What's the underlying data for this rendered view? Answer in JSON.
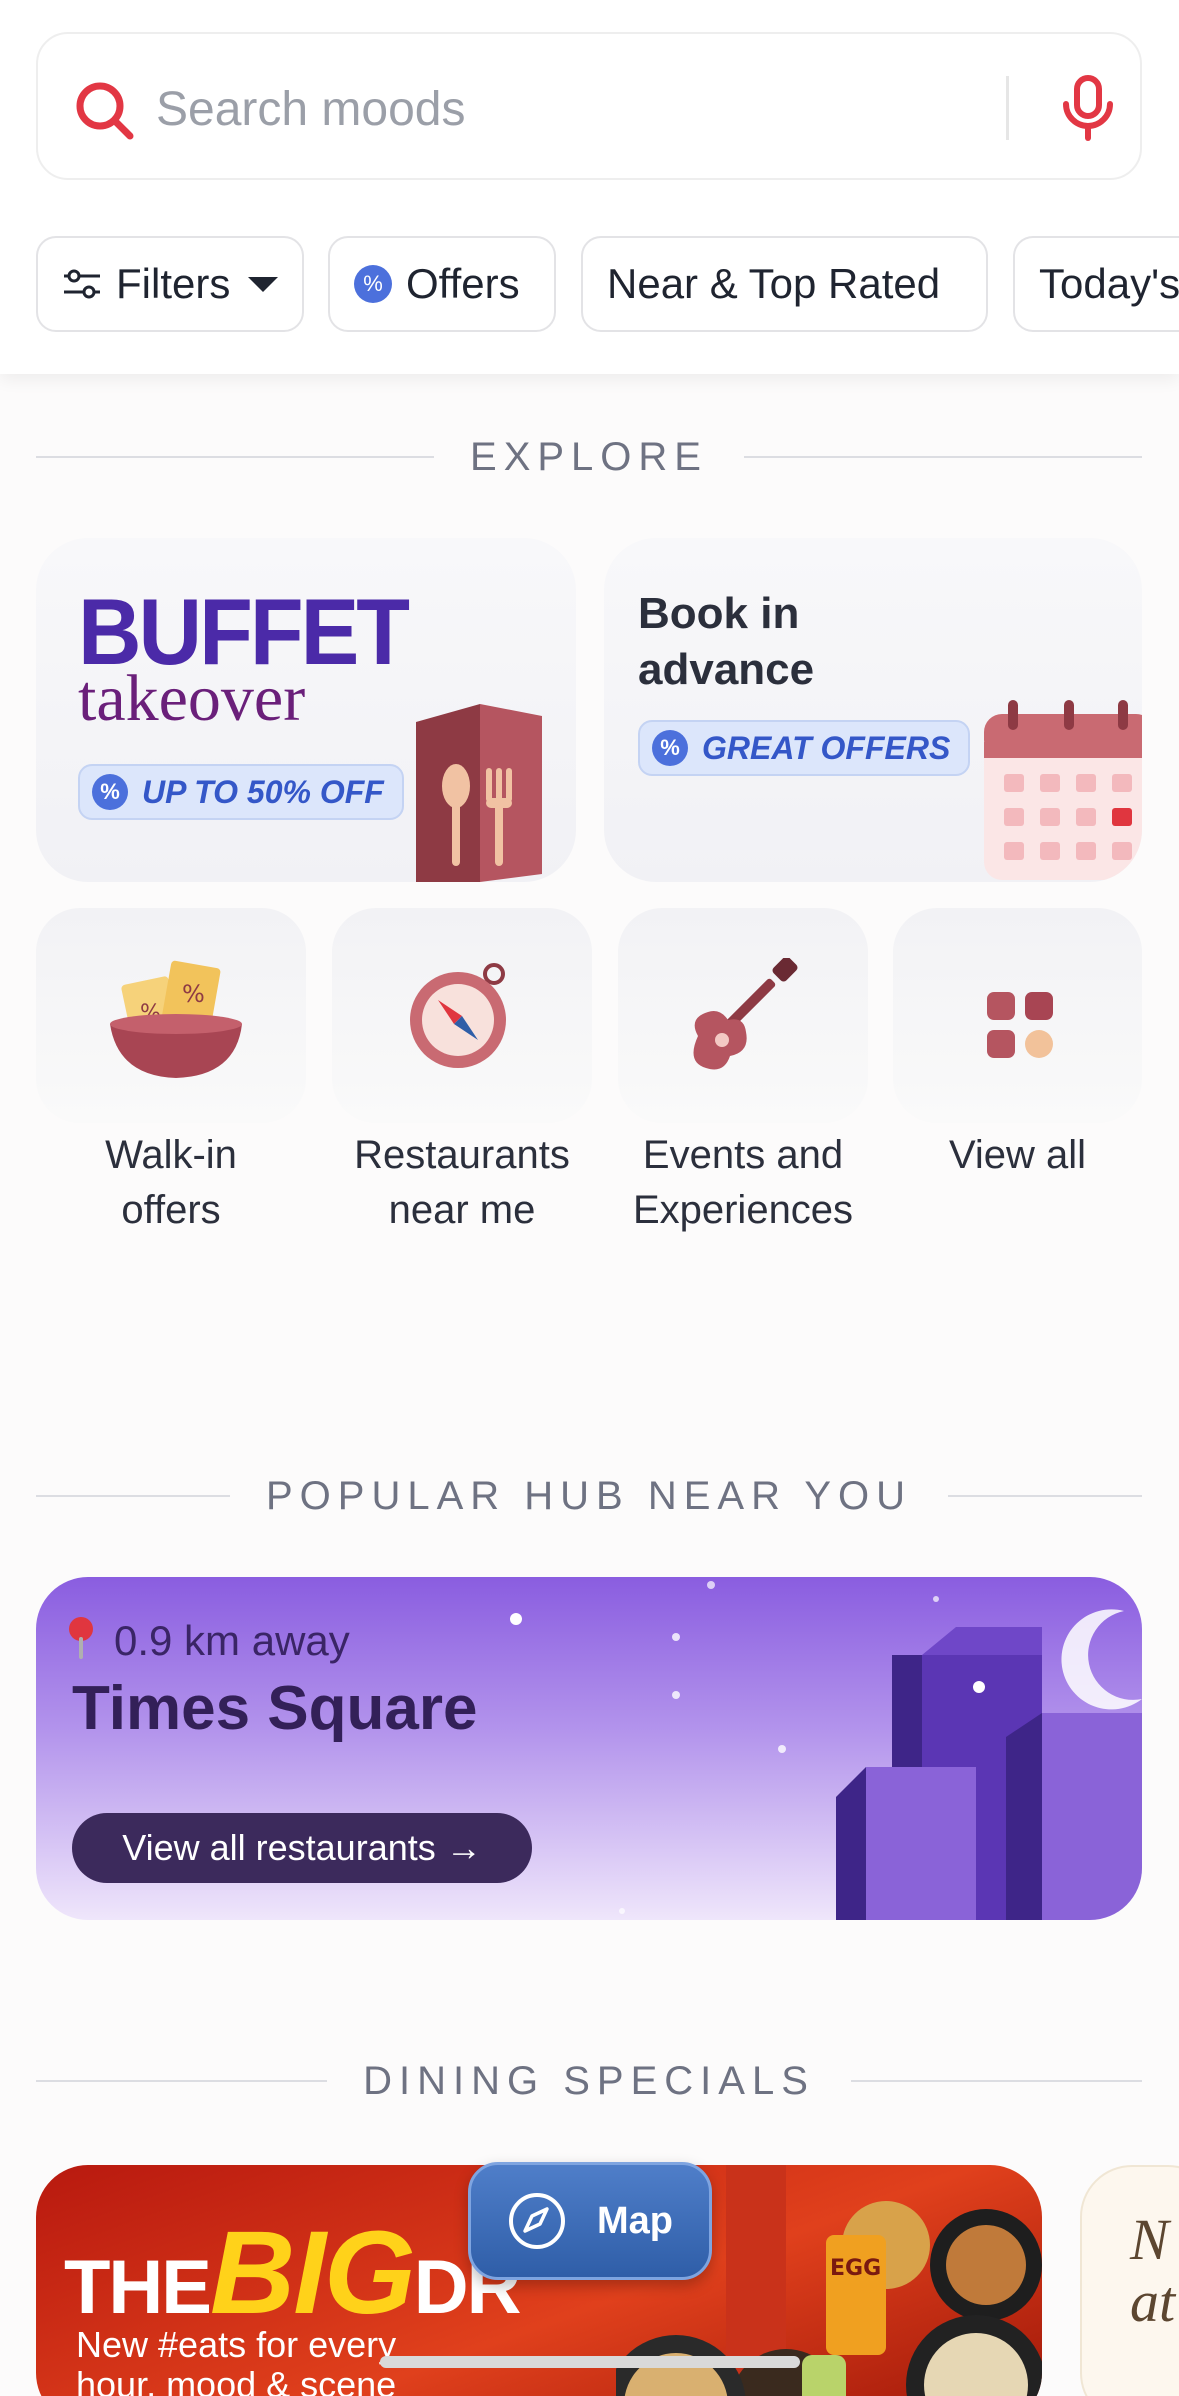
{
  "search": {
    "placeholder": "Search moods"
  },
  "chips": [
    {
      "label": "Filters"
    },
    {
      "label": "Offers"
    },
    {
      "label": "Near & Top Rated"
    },
    {
      "label": "Today's"
    }
  ],
  "explore": {
    "heading": "EXPLORE",
    "buffet": {
      "line1": "BUFFET",
      "line2": "takeover",
      "offer": "UP TO 50% OFF"
    },
    "book": {
      "line1": "Book in",
      "line2": "advance",
      "offer": "GREAT OFFERS"
    },
    "tiles": [
      {
        "line1": "Walk-in",
        "line2": "offers"
      },
      {
        "line1": "Restaurants",
        "line2": "near me"
      },
      {
        "line1": "Events and",
        "line2": "Experiences"
      },
      {
        "line1": "View all",
        "line2": ""
      }
    ]
  },
  "hub": {
    "heading": "POPULAR HUB NEAR YOU",
    "distance": "0.9 km away",
    "place": "Times Square",
    "button": "View all restaurants →"
  },
  "specials": {
    "heading": "DINING SPECIALS",
    "promo_title_a": "THE",
    "promo_title_b": "BIG",
    "promo_title_c": "DR",
    "promo_sub1": "New #eats for every",
    "promo_sub2": "hour, mood & scene",
    "side_text": "N g at"
  },
  "map_button": {
    "label": "Map"
  },
  "colors": {
    "accent": "#e23744",
    "hub_purple": "#8a5de0",
    "map_blue": "#2f5ea8"
  }
}
